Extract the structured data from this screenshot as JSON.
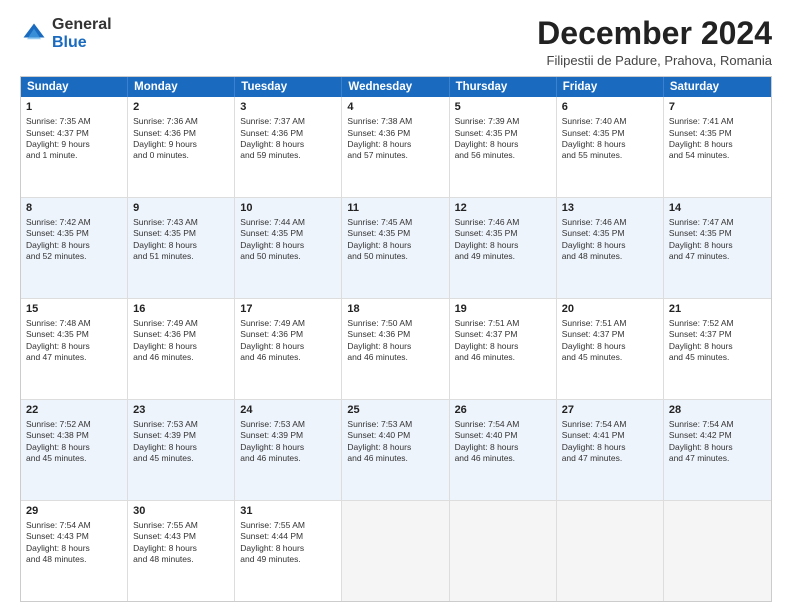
{
  "header": {
    "logo_general": "General",
    "logo_blue": "Blue",
    "month_title": "December 2024",
    "subtitle": "Filipestii de Padure, Prahova, Romania"
  },
  "days_of_week": [
    "Sunday",
    "Monday",
    "Tuesday",
    "Wednesday",
    "Thursday",
    "Friday",
    "Saturday"
  ],
  "weeks": [
    [
      {
        "day": "1",
        "lines": [
          "Sunrise: 7:35 AM",
          "Sunset: 4:37 PM",
          "Daylight: 9 hours",
          "and 1 minute."
        ]
      },
      {
        "day": "2",
        "lines": [
          "Sunrise: 7:36 AM",
          "Sunset: 4:36 PM",
          "Daylight: 9 hours",
          "and 0 minutes."
        ]
      },
      {
        "day": "3",
        "lines": [
          "Sunrise: 7:37 AM",
          "Sunset: 4:36 PM",
          "Daylight: 8 hours",
          "and 59 minutes."
        ]
      },
      {
        "day": "4",
        "lines": [
          "Sunrise: 7:38 AM",
          "Sunset: 4:36 PM",
          "Daylight: 8 hours",
          "and 57 minutes."
        ]
      },
      {
        "day": "5",
        "lines": [
          "Sunrise: 7:39 AM",
          "Sunset: 4:35 PM",
          "Daylight: 8 hours",
          "and 56 minutes."
        ]
      },
      {
        "day": "6",
        "lines": [
          "Sunrise: 7:40 AM",
          "Sunset: 4:35 PM",
          "Daylight: 8 hours",
          "and 55 minutes."
        ]
      },
      {
        "day": "7",
        "lines": [
          "Sunrise: 7:41 AM",
          "Sunset: 4:35 PM",
          "Daylight: 8 hours",
          "and 54 minutes."
        ]
      }
    ],
    [
      {
        "day": "8",
        "lines": [
          "Sunrise: 7:42 AM",
          "Sunset: 4:35 PM",
          "Daylight: 8 hours",
          "and 52 minutes."
        ]
      },
      {
        "day": "9",
        "lines": [
          "Sunrise: 7:43 AM",
          "Sunset: 4:35 PM",
          "Daylight: 8 hours",
          "and 51 minutes."
        ]
      },
      {
        "day": "10",
        "lines": [
          "Sunrise: 7:44 AM",
          "Sunset: 4:35 PM",
          "Daylight: 8 hours",
          "and 50 minutes."
        ]
      },
      {
        "day": "11",
        "lines": [
          "Sunrise: 7:45 AM",
          "Sunset: 4:35 PM",
          "Daylight: 8 hours",
          "and 50 minutes."
        ]
      },
      {
        "day": "12",
        "lines": [
          "Sunrise: 7:46 AM",
          "Sunset: 4:35 PM",
          "Daylight: 8 hours",
          "and 49 minutes."
        ]
      },
      {
        "day": "13",
        "lines": [
          "Sunrise: 7:46 AM",
          "Sunset: 4:35 PM",
          "Daylight: 8 hours",
          "and 48 minutes."
        ]
      },
      {
        "day": "14",
        "lines": [
          "Sunrise: 7:47 AM",
          "Sunset: 4:35 PM",
          "Daylight: 8 hours",
          "and 47 minutes."
        ]
      }
    ],
    [
      {
        "day": "15",
        "lines": [
          "Sunrise: 7:48 AM",
          "Sunset: 4:35 PM",
          "Daylight: 8 hours",
          "and 47 minutes."
        ]
      },
      {
        "day": "16",
        "lines": [
          "Sunrise: 7:49 AM",
          "Sunset: 4:36 PM",
          "Daylight: 8 hours",
          "and 46 minutes."
        ]
      },
      {
        "day": "17",
        "lines": [
          "Sunrise: 7:49 AM",
          "Sunset: 4:36 PM",
          "Daylight: 8 hours",
          "and 46 minutes."
        ]
      },
      {
        "day": "18",
        "lines": [
          "Sunrise: 7:50 AM",
          "Sunset: 4:36 PM",
          "Daylight: 8 hours",
          "and 46 minutes."
        ]
      },
      {
        "day": "19",
        "lines": [
          "Sunrise: 7:51 AM",
          "Sunset: 4:37 PM",
          "Daylight: 8 hours",
          "and 46 minutes."
        ]
      },
      {
        "day": "20",
        "lines": [
          "Sunrise: 7:51 AM",
          "Sunset: 4:37 PM",
          "Daylight: 8 hours",
          "and 45 minutes."
        ]
      },
      {
        "day": "21",
        "lines": [
          "Sunrise: 7:52 AM",
          "Sunset: 4:37 PM",
          "Daylight: 8 hours",
          "and 45 minutes."
        ]
      }
    ],
    [
      {
        "day": "22",
        "lines": [
          "Sunrise: 7:52 AM",
          "Sunset: 4:38 PM",
          "Daylight: 8 hours",
          "and 45 minutes."
        ]
      },
      {
        "day": "23",
        "lines": [
          "Sunrise: 7:53 AM",
          "Sunset: 4:39 PM",
          "Daylight: 8 hours",
          "and 45 minutes."
        ]
      },
      {
        "day": "24",
        "lines": [
          "Sunrise: 7:53 AM",
          "Sunset: 4:39 PM",
          "Daylight: 8 hours",
          "and 46 minutes."
        ]
      },
      {
        "day": "25",
        "lines": [
          "Sunrise: 7:53 AM",
          "Sunset: 4:40 PM",
          "Daylight: 8 hours",
          "and 46 minutes."
        ]
      },
      {
        "day": "26",
        "lines": [
          "Sunrise: 7:54 AM",
          "Sunset: 4:40 PM",
          "Daylight: 8 hours",
          "and 46 minutes."
        ]
      },
      {
        "day": "27",
        "lines": [
          "Sunrise: 7:54 AM",
          "Sunset: 4:41 PM",
          "Daylight: 8 hours",
          "and 47 minutes."
        ]
      },
      {
        "day": "28",
        "lines": [
          "Sunrise: 7:54 AM",
          "Sunset: 4:42 PM",
          "Daylight: 8 hours",
          "and 47 minutes."
        ]
      }
    ],
    [
      {
        "day": "29",
        "lines": [
          "Sunrise: 7:54 AM",
          "Sunset: 4:43 PM",
          "Daylight: 8 hours",
          "and 48 minutes."
        ]
      },
      {
        "day": "30",
        "lines": [
          "Sunrise: 7:55 AM",
          "Sunset: 4:43 PM",
          "Daylight: 8 hours",
          "and 48 minutes."
        ]
      },
      {
        "day": "31",
        "lines": [
          "Sunrise: 7:55 AM",
          "Sunset: 4:44 PM",
          "Daylight: 8 hours",
          "and 49 minutes."
        ]
      },
      null,
      null,
      null,
      null
    ]
  ]
}
